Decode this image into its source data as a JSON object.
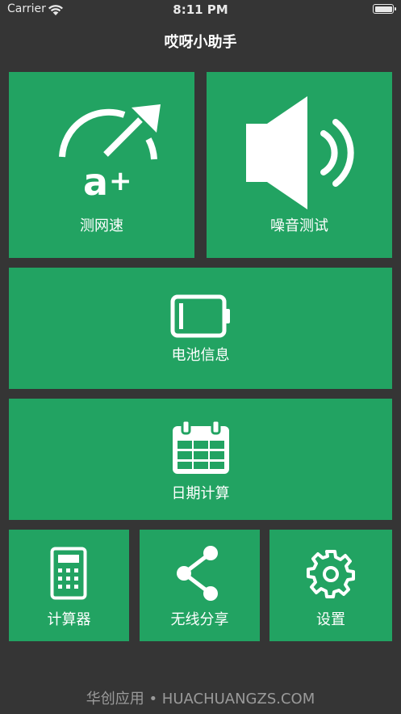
{
  "status_bar": {
    "carrier": "Carrier",
    "time": "8:11 PM"
  },
  "nav": {
    "title": "哎呀小助手"
  },
  "tiles": {
    "speed_test": {
      "label": "测网速",
      "icon": "speedometer-icon"
    },
    "noise_test": {
      "label": "噪音测试",
      "icon": "speaker-icon"
    },
    "battery_info": {
      "label": "电池信息",
      "icon": "battery-icon"
    },
    "date_calc": {
      "label": "日期计算",
      "icon": "calendar-icon"
    },
    "calculator": {
      "label": "计算器",
      "icon": "calculator-icon"
    },
    "wireless_share": {
      "label": "无线分享",
      "icon": "share-icon"
    },
    "settings": {
      "label": "设置",
      "icon": "gear-icon"
    }
  },
  "watermark": "华创应用 • HUACHUANGZS.COM",
  "colors": {
    "background": "#353535",
    "tile": "#22a362",
    "text": "#ffffff"
  }
}
